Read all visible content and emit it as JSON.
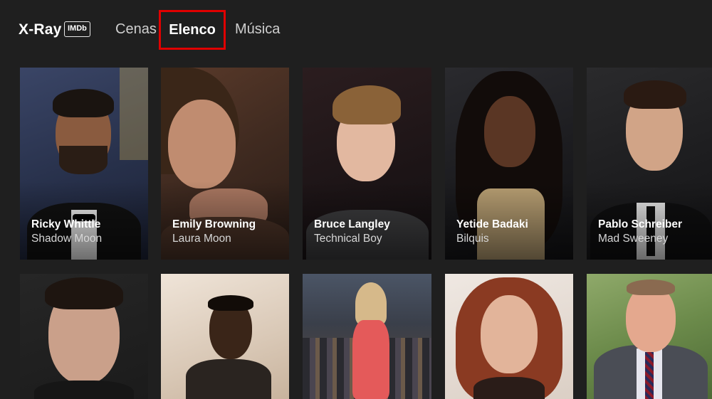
{
  "header": {
    "brand": "X-Ray",
    "imdb_badge": "IMDb",
    "tabs": [
      {
        "label": "Cenas",
        "active": false
      },
      {
        "label": "Elenco",
        "active": true
      },
      {
        "label": "Música",
        "active": false
      }
    ]
  },
  "cast_row1": [
    {
      "name": "Ricky Whittle",
      "role": "Shadow Moon"
    },
    {
      "name": "Emily Browning",
      "role": "Laura Moon"
    },
    {
      "name": "Bruce Langley",
      "role": "Technical Boy"
    },
    {
      "name": "Yetide Badaki",
      "role": "Bilquis"
    },
    {
      "name": "Pablo Schreiber",
      "role": "Mad Sweeney"
    }
  ],
  "colors": {
    "background": "#1f1f1f",
    "highlight": "#e00000"
  }
}
